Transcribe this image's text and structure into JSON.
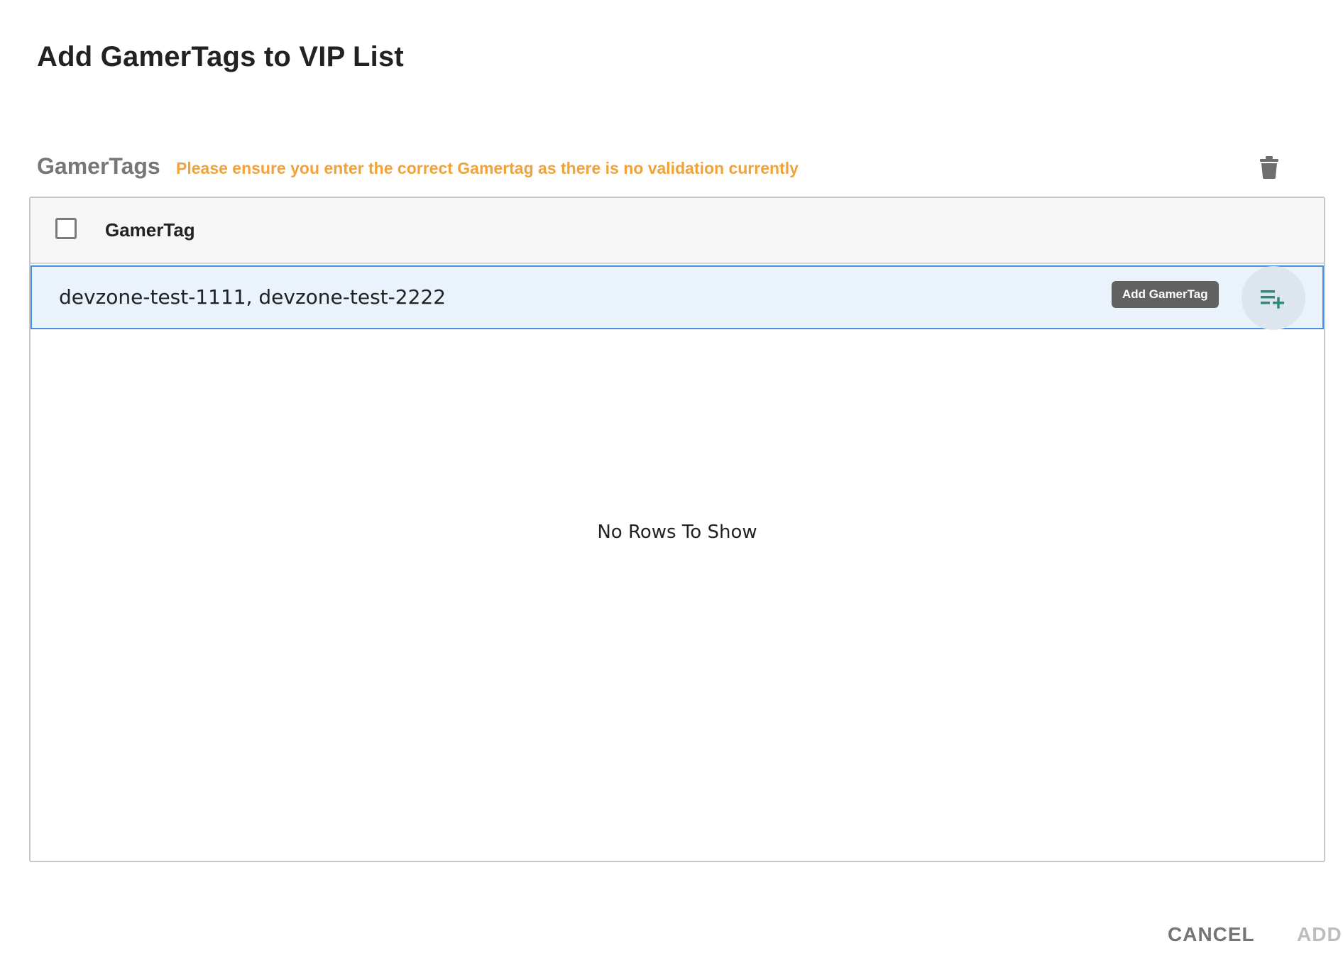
{
  "dialog": {
    "title": "Add GamerTags to VIP List"
  },
  "section": {
    "label": "GamerTags",
    "warning": "Please ensure you enter the correct Gamertag as there is no validation currently",
    "warning_color": "#f2a23a",
    "delete_icon": "trash-icon"
  },
  "grid": {
    "column_header": "GamerTag",
    "input_value": "devzone-test-1111, devzone-test-2222",
    "tooltip": "Add GamerTag",
    "add_icon": "playlist-add-icon",
    "add_icon_color": "#2e8b7a",
    "empty_message": "No Rows To Show",
    "row_highlight_color": "#eaf3fc",
    "row_border_color": "#4a90e2"
  },
  "actions": {
    "cancel_label": "CANCEL",
    "add_label": "ADD"
  }
}
